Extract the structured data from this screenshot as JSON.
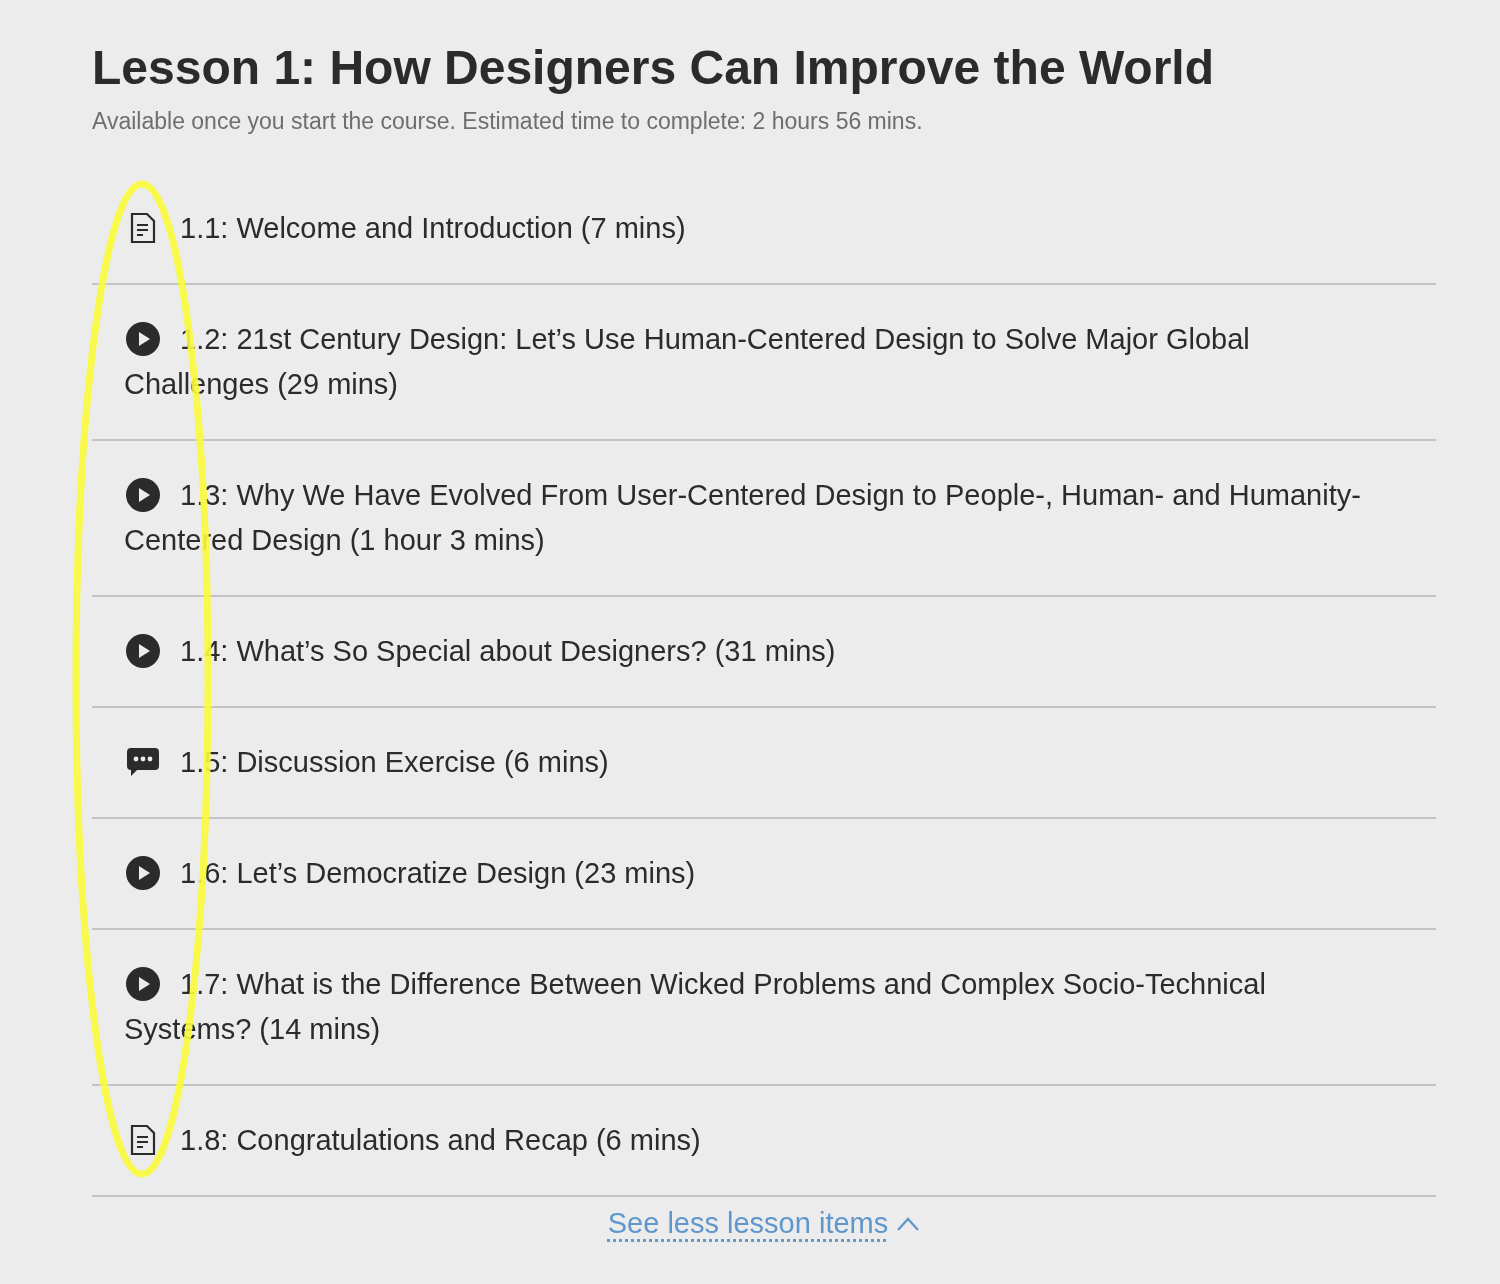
{
  "lesson": {
    "title": "Lesson 1: How Designers Can Improve the World",
    "subtitle": "Available once you start the course. Estimated time to complete: 2 hours 56 mins."
  },
  "items": [
    {
      "kind": "document",
      "label": "1.1: Welcome and Introduction (7 mins)"
    },
    {
      "kind": "video",
      "label": "1.2: 21st Century Design: Let’s Use Human-Centered Design to Solve Major Global Challenges (29 mins)"
    },
    {
      "kind": "video",
      "label": "1.3: Why We Have Evolved From User-Centered Design to People-, Human- and Humanity-Centered Design (1 hour 3 mins)"
    },
    {
      "kind": "video",
      "label": "1.4: What’s So Special about Designers? (31 mins)"
    },
    {
      "kind": "discussion",
      "label": "1.5: Discussion Exercise (6 mins)"
    },
    {
      "kind": "video",
      "label": "1.6: Let’s Democratize Design (23 mins)"
    },
    {
      "kind": "video",
      "label": "1.7: What is the Difference Between Wicked Problems and Complex Socio-Technical Systems? (14 mins)"
    },
    {
      "kind": "document",
      "label": "1.8: Congratulations and Recap (6 mins)"
    }
  ],
  "toggle": {
    "label": "See less lesson items",
    "expanded": true
  }
}
